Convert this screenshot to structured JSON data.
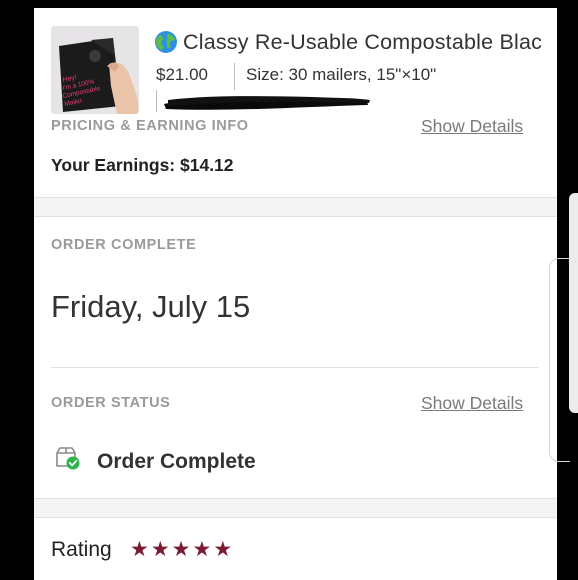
{
  "product": {
    "title": "Classy Re-Usable Compostable Blac",
    "price": "$21.00",
    "size": "Size: 30 mailers, 15\"×10\"",
    "thumb_text": "Hey! I'm a 100% Compostable Mailer."
  },
  "pricing": {
    "label": "PRICING & EARNING INFO",
    "show_details": "Show Details",
    "earnings": "Your Earnings: $14.12"
  },
  "order_complete": {
    "label": "ORDER COMPLETE",
    "date": "Friday, July 15"
  },
  "order_status": {
    "label": "ORDER STATUS",
    "show_details": "Show Details",
    "status": "Order Complete"
  },
  "rating": {
    "label": "Rating",
    "stars": 5,
    "max": 5
  },
  "colors": {
    "star": "#7b1a33",
    "status_check": "#2db34a",
    "muted_text": "#9a9a9a",
    "link_text": "#7a7a7a"
  },
  "icons": {
    "title_icon": "globe-icon",
    "status_icon": "package-check-icon",
    "star_icon": "star-icon"
  }
}
